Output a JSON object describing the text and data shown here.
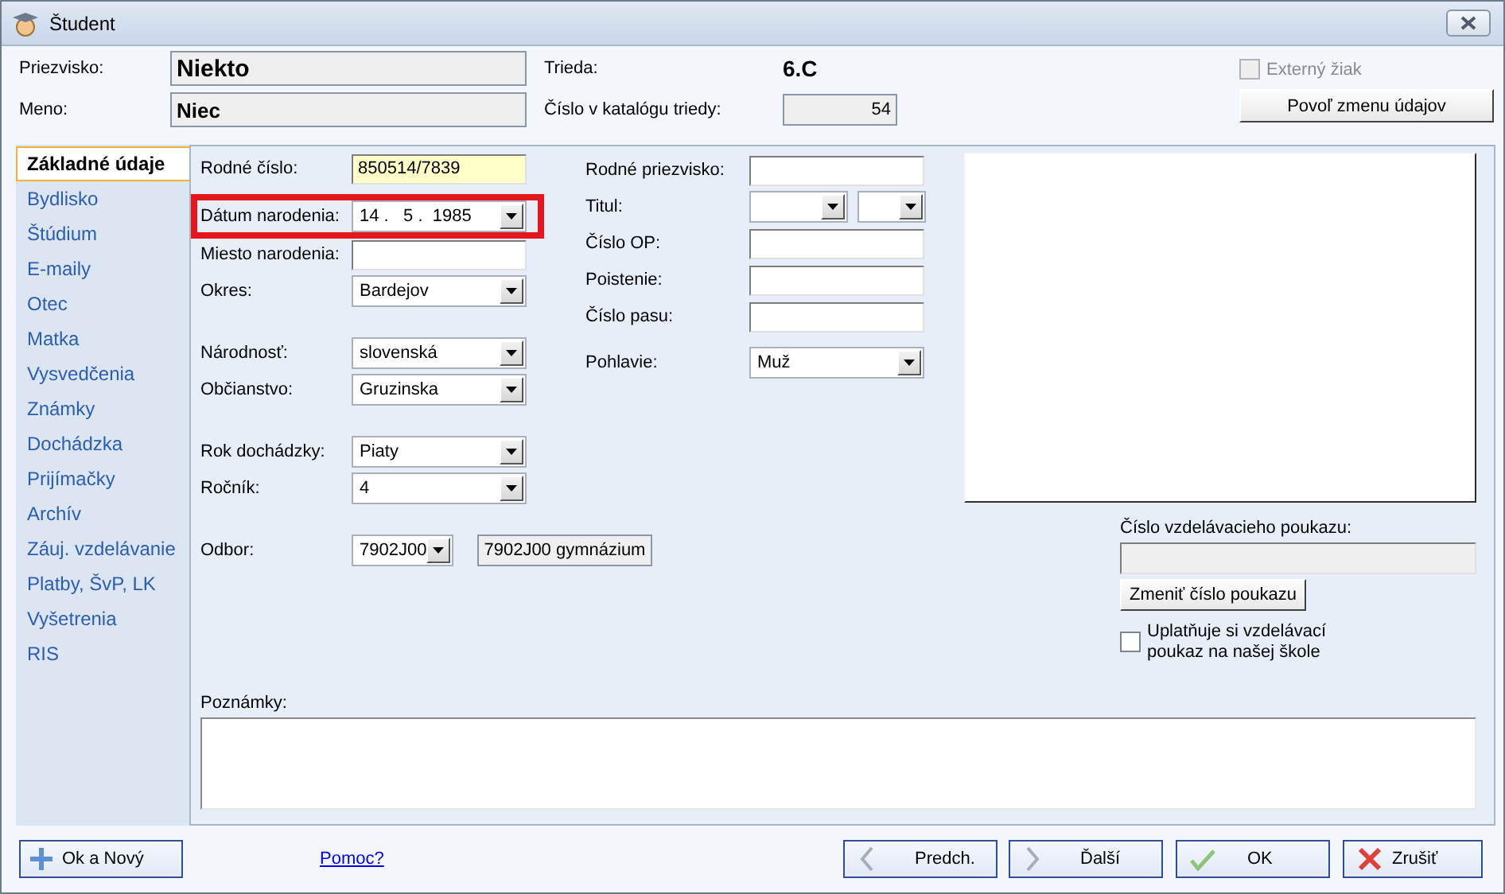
{
  "window": {
    "title": "Študent"
  },
  "header": {
    "surname": {
      "label": "Priezvisko:",
      "value": "Niekto"
    },
    "first_name": {
      "label": "Meno:",
      "value": "Niec"
    },
    "class": {
      "label": "Trieda:",
      "value": "6.C"
    },
    "catalog_number": {
      "label": "Číslo v katalógu triedy:",
      "value": "54"
    },
    "external": {
      "label": "Externý žiak",
      "checked": false,
      "disabled": true
    },
    "allow_edit_button": "Povoľ zmenu údajov"
  },
  "tabs": [
    {
      "label": "Základné údaje",
      "selected": true
    },
    {
      "label": "Bydlisko",
      "selected": false
    },
    {
      "label": "Štúdium",
      "selected": false
    },
    {
      "label": "E-maily",
      "selected": false
    },
    {
      "label": "Otec",
      "selected": false
    },
    {
      "label": "Matka",
      "selected": false
    },
    {
      "label": "Vysvedčenia",
      "selected": false
    },
    {
      "label": "Známky",
      "selected": false
    },
    {
      "label": "Dochádzka",
      "selected": false
    },
    {
      "label": "Prijímačky",
      "selected": false
    },
    {
      "label": "Archív",
      "selected": false
    },
    {
      "label": "Záuj. vzdelávanie",
      "selected": false
    },
    {
      "label": "Platby, ŠvP, LK",
      "selected": false
    },
    {
      "label": "Vyšetrenia",
      "selected": false
    },
    {
      "label": "RIS",
      "selected": false
    }
  ],
  "left_groups": [
    [
      {
        "label": "Rodné číslo:",
        "kind": "text",
        "value": "850514/7839",
        "emphasized": true
      },
      {
        "label": "Dátum narodenia:",
        "kind": "date",
        "value": "14 .   5 .  1985",
        "marked": true
      },
      {
        "label": "Miesto narodenia:",
        "kind": "text"
      },
      {
        "label": "Okres:",
        "kind": "combo",
        "value": "Bardejov"
      }
    ],
    [
      {
        "label": "Národnosť:",
        "kind": "combo",
        "value": "slovenská"
      },
      {
        "label": "Občianstvo:",
        "kind": "combo",
        "value": "Gruzinska"
      }
    ],
    [
      {
        "label": "Rok dochádzky:",
        "kind": "combo",
        "value": "Piaty"
      },
      {
        "label": "Ročník:",
        "kind": "combo",
        "value": "4"
      }
    ],
    [
      {
        "label": "Odbor:",
        "kind": "combo_with_text",
        "value": "7902J00",
        "description": "7902J00 gymnázium"
      }
    ]
  ],
  "middle_fields": [
    {
      "label": "Rodné priezvisko:",
      "kind": "text"
    },
    {
      "label": "Titul:",
      "kind": "combo_pair"
    },
    {
      "label": "Číslo OP:",
      "kind": "text"
    },
    {
      "label": "Poistenie:",
      "kind": "text"
    },
    {
      "label": "Číslo pasu:",
      "kind": "text"
    },
    {
      "label": "Pohlavie:",
      "kind": "combo",
      "value": "Muž"
    }
  ],
  "voucher": {
    "label": "Číslo vzdelávacieho poukazu:",
    "disabled": true,
    "button": "Zmeniť číslo poukazu",
    "claim": {
      "label": "Uplatňuje si vzdelávací poukaz na našej škole",
      "checked": false
    }
  },
  "notes": {
    "label": "Poznámky:"
  },
  "footer": {
    "new_button": "Ok a Nový",
    "help_link": "Pomoc?",
    "buttons": [
      {
        "label": "Predch.",
        "kind": "prev"
      },
      {
        "label": "Ďalší",
        "kind": "next"
      },
      {
        "label": "OK",
        "kind": "ok"
      },
      {
        "label": "Zrušiť",
        "kind": "cancel"
      }
    ]
  }
}
